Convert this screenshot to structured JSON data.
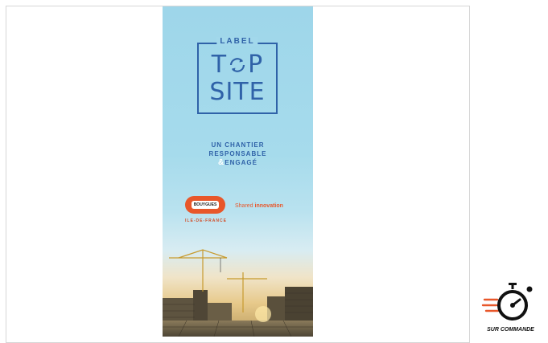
{
  "banner": {
    "label_word": "LABEL",
    "logo_line1": "T  P",
    "logo_line2": "SITE",
    "tagline_line1": "UN CHANTIER",
    "tagline_line2": "RESPONSABLE",
    "tagline_amp": "&",
    "tagline_line3": "ENGAGÉ",
    "brand_badge": "BOUYGUES",
    "brand_region": "ILE-DE-FRANCE",
    "shared_word": "Shared",
    "innovation_word": "innovation"
  },
  "badge": {
    "label": "SUR COMMANDE",
    "icon": "stopwatch-icon"
  },
  "colors": {
    "logo_blue": "#2f62a8",
    "brand_orange": "#e8572a",
    "sky": "#9ed6ea",
    "speed_lines": "#e8572a"
  }
}
